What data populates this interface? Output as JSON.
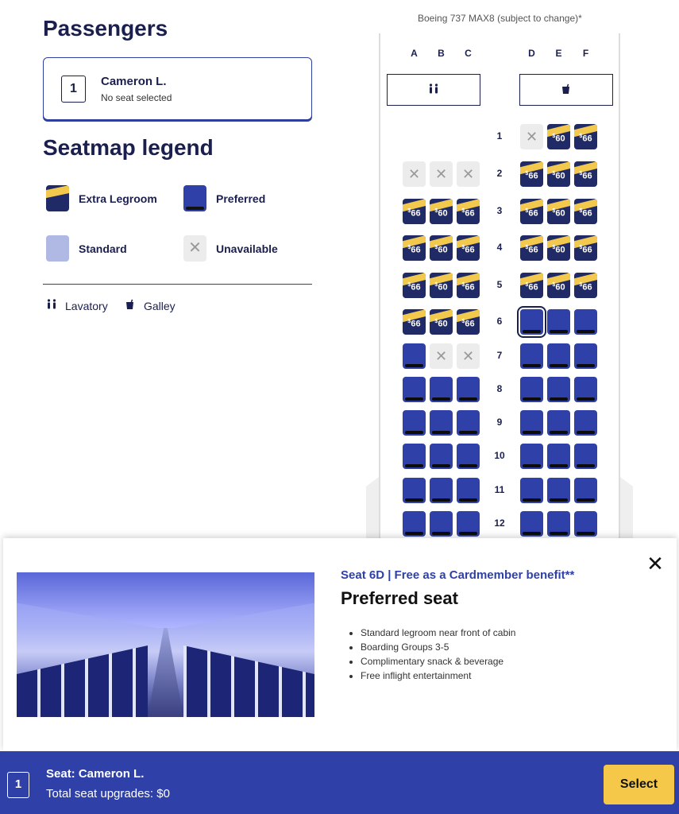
{
  "passengers": {
    "title": "Passengers",
    "list": [
      {
        "number": "1",
        "name": "Cameron L.",
        "seat_status": "No seat selected"
      }
    ]
  },
  "legend": {
    "title": "Seatmap legend",
    "items": {
      "extra_legroom": "Extra Legroom",
      "preferred": "Preferred",
      "standard": "Standard",
      "unavailable": "Unavailable"
    },
    "facilities": {
      "lavatory": "Lavatory",
      "galley": "Galley"
    }
  },
  "seatmap": {
    "aircraft": "Boeing 737 MAX8 (subject to change)*",
    "columns": [
      "A",
      "B",
      "C",
      "D",
      "E",
      "F"
    ],
    "price_symbol": "$",
    "rows": [
      {
        "row": "1",
        "seats": [
          "",
          "",
          "",
          "X",
          "60",
          "66"
        ]
      },
      {
        "row": "2",
        "seats": [
          "X",
          "X",
          "X",
          "66",
          "60",
          "66"
        ]
      },
      {
        "row": "3",
        "seats": [
          "66",
          "60",
          "66",
          "66",
          "60",
          "66"
        ]
      },
      {
        "row": "4",
        "seats": [
          "66",
          "60",
          "66",
          "66",
          "60",
          "66"
        ]
      },
      {
        "row": "5",
        "seats": [
          "66",
          "60",
          "66",
          "66",
          "60",
          "66"
        ]
      },
      {
        "row": "6",
        "seats": [
          "66",
          "60",
          "66",
          "P*",
          "P",
          "P"
        ]
      },
      {
        "row": "7",
        "seats": [
          "P",
          "X",
          "X",
          "P",
          "P",
          "P"
        ]
      },
      {
        "row": "8",
        "seats": [
          "P",
          "P",
          "P",
          "P",
          "P",
          "P"
        ]
      },
      {
        "row": "9",
        "seats": [
          "P",
          "P",
          "P",
          "P",
          "P",
          "P"
        ]
      },
      {
        "row": "10",
        "seats": [
          "P",
          "P",
          "P",
          "P",
          "P",
          "P"
        ]
      },
      {
        "row": "11",
        "seats": [
          "P",
          "P",
          "P",
          "P",
          "P",
          "P"
        ]
      },
      {
        "row": "12",
        "seats": [
          "P",
          "P",
          "P",
          "P",
          "P",
          "P"
        ]
      }
    ]
  },
  "detail": {
    "subtitle": "Seat 6D | Free as a Cardmember benefit**",
    "title": "Preferred seat",
    "features": [
      "Standard legroom near front of cabin",
      "Boarding Groups 3-5",
      "Complimentary snack & beverage",
      "Free inflight entertainment"
    ],
    "close_icon": "✕"
  },
  "bottom_bar": {
    "passenger_number": "1",
    "seat_label": "Seat: Cameron L.",
    "total_label": "Total seat upgrades: $0",
    "select_label": "Select"
  },
  "icons": {
    "lavatory": "lavatory-icon",
    "galley": "galley-icon",
    "unavailable": "close-icon"
  },
  "colors": {
    "navy": "#1a1f4e",
    "preferred_blue": "#2f41a8",
    "gold": "#f2c94c",
    "standard": "#b0b9e3",
    "select_button": "#f5c84a"
  }
}
